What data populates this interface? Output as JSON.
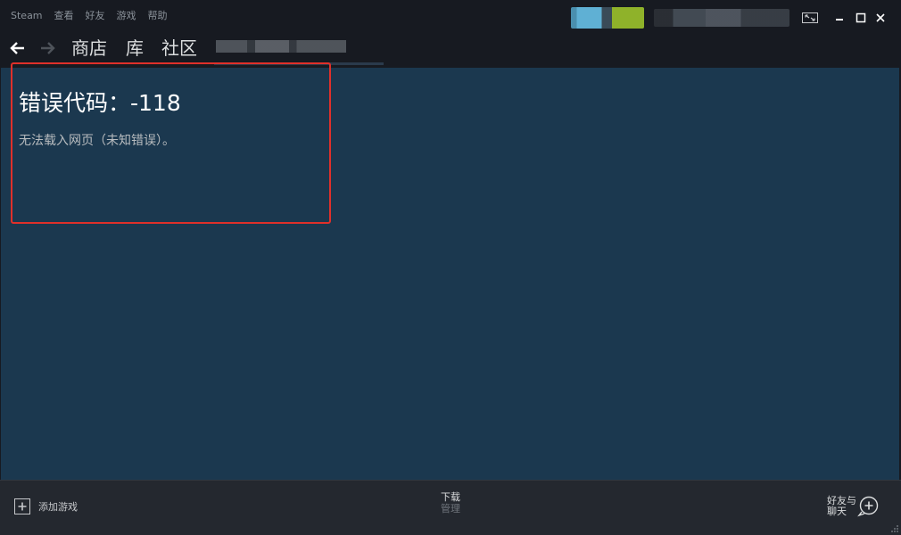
{
  "menubar": {
    "items": [
      "Steam",
      "查看",
      "好友",
      "游戏",
      "帮助"
    ]
  },
  "nav": {
    "store": "商店",
    "library": "库",
    "community": "社区"
  },
  "content": {
    "error_title": "错误代码：-118",
    "error_message": "无法载入网页（未知错误）。"
  },
  "footer": {
    "add_game": "添加游戏",
    "downloads": "下载",
    "downloads_sub": "管理",
    "friends_line1": "好友与",
    "friends_line2": "聊天"
  },
  "icons": {
    "back": "arrow-left-icon",
    "forward": "arrow-right-icon",
    "big_picture": "big-picture-icon",
    "minimize": "minimize-icon",
    "maximize": "maximize-icon",
    "close": "close-icon",
    "add": "plus-icon",
    "friends_add": "plus-circle-icon"
  },
  "colors": {
    "highlight": "#e0302a",
    "content_bg": "#1b384f",
    "chrome_bg": "#171a21",
    "footer_bg": "#24282f"
  }
}
